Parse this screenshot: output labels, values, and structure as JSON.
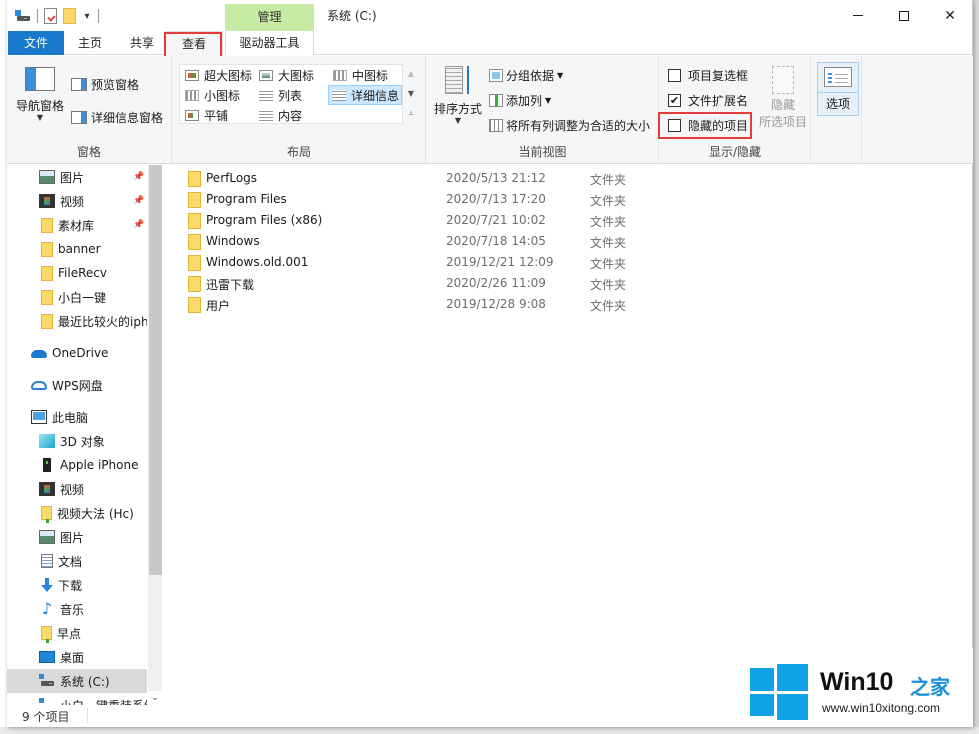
{
  "window": {
    "title": "系统 (C:)",
    "context_tab_group": "管理",
    "controls": {
      "minimize": "minimize",
      "maximize": "maximize",
      "close": "✕"
    }
  },
  "tabs": [
    {
      "label": "文件",
      "active": false,
      "highlighted": false
    },
    {
      "label": "主页",
      "active": false,
      "highlighted": false
    },
    {
      "label": "共享",
      "active": false,
      "highlighted": false
    },
    {
      "label": "查看",
      "active": true,
      "highlighted": true
    },
    {
      "label": "驱动器工具",
      "active": false,
      "highlighted": false
    }
  ],
  "ribbon": {
    "pane_group": {
      "label": "窗格",
      "nav_pane": "导航窗格",
      "preview_pane": "预览窗格",
      "details_pane": "详细信息窗格"
    },
    "layout_group": {
      "label": "布局",
      "items": [
        {
          "label": "超大图标",
          "selected": false
        },
        {
          "label": "大图标",
          "selected": false
        },
        {
          "label": "中图标",
          "selected": false
        },
        {
          "label": "小图标",
          "selected": false
        },
        {
          "label": "列表",
          "selected": false
        },
        {
          "label": "详细信息",
          "selected": true
        },
        {
          "label": "平铺",
          "selected": false
        },
        {
          "label": "内容",
          "selected": false
        }
      ]
    },
    "current_view_group": {
      "label": "当前视图",
      "sort_by": "排序方式",
      "group_by": "分组依据",
      "add_column": "添加列",
      "size_all_columns": "将所有列调整为合适的大小"
    },
    "show_hide_group": {
      "label": "显示/隐藏",
      "item_checkboxes": {
        "label": "项目复选框",
        "checked": false
      },
      "file_extensions": {
        "label": "文件扩展名",
        "checked": true
      },
      "hidden_items": {
        "label": "隐藏的项目",
        "checked": false,
        "highlighted": true
      },
      "hide_selected_line1": "隐藏",
      "hide_selected_line2": "所选项目"
    },
    "options": {
      "label": "选项"
    }
  },
  "nav_pane": {
    "items": [
      {
        "label": "图片",
        "icon": "pictures-icon",
        "pinned": true
      },
      {
        "label": "视频",
        "icon": "video-icon",
        "pinned": true
      },
      {
        "label": "素材库",
        "icon": "folder-icon",
        "pinned": true
      },
      {
        "label": "banner",
        "icon": "folder-icon",
        "pinned": false
      },
      {
        "label": "FileRecv",
        "icon": "folder-icon",
        "pinned": false
      },
      {
        "label": "小白一键",
        "icon": "folder-icon",
        "pinned": false
      },
      {
        "label": "最近比较火的iph",
        "icon": "folder-icon",
        "pinned": false
      },
      {
        "label": "OneDrive",
        "icon": "onedrive-icon",
        "pinned": false
      },
      {
        "label": "WPS网盘",
        "icon": "cloud-icon",
        "pinned": false
      },
      {
        "label": "此电脑",
        "icon": "pc-icon",
        "pinned": false
      },
      {
        "label": "3D 对象",
        "icon": "3d-objects-icon",
        "pinned": false
      },
      {
        "label": "Apple iPhone",
        "icon": "phone-icon",
        "pinned": false
      },
      {
        "label": "视频",
        "icon": "video-icon",
        "pinned": false
      },
      {
        "label": "视频大法 (Hc)",
        "icon": "network-folder-icon",
        "pinned": false
      },
      {
        "label": "图片",
        "icon": "pictures-icon",
        "pinned": false
      },
      {
        "label": "文档",
        "icon": "documents-icon",
        "pinned": false
      },
      {
        "label": "下载",
        "icon": "download-icon",
        "pinned": false
      },
      {
        "label": "音乐",
        "icon": "music-icon",
        "pinned": false
      },
      {
        "label": "早点",
        "icon": "network-folder-icon",
        "pinned": false
      },
      {
        "label": "桌面",
        "icon": "desktop-icon",
        "pinned": false
      },
      {
        "label": "系统 (C:)",
        "icon": "drive-icon",
        "pinned": false,
        "selected": true
      },
      {
        "label": "小白一键重装系统",
        "icon": "drive-icon",
        "pinned": false
      }
    ]
  },
  "files": [
    {
      "name": "PerfLogs",
      "date": "2020/5/13 21:12",
      "type": "文件夹"
    },
    {
      "name": "Program Files",
      "date": "2020/7/13 17:20",
      "type": "文件夹"
    },
    {
      "name": "Program Files (x86)",
      "date": "2020/7/21 10:02",
      "type": "文件夹"
    },
    {
      "name": "Windows",
      "date": "2020/7/18 14:05",
      "type": "文件夹"
    },
    {
      "name": "Windows.old.001",
      "date": "2019/12/21 12:09",
      "type": "文件夹"
    },
    {
      "name": "迅雷下载",
      "date": "2020/2/26 11:09",
      "type": "文件夹"
    },
    {
      "name": "用户",
      "date": "2019/12/28 9:08",
      "type": "文件夹"
    }
  ],
  "status": {
    "item_count": "9 个项目"
  },
  "watermark": {
    "title": "Win10",
    "title_cn": "之家",
    "url": "www.win10xitong.com"
  },
  "colors": {
    "accent": "#1979ca",
    "highlight_box": "#e53b3b",
    "context_tab": "#c7eaa5",
    "selected_layout": "#cce8ff",
    "watermark_blue": "#10a1e6"
  }
}
